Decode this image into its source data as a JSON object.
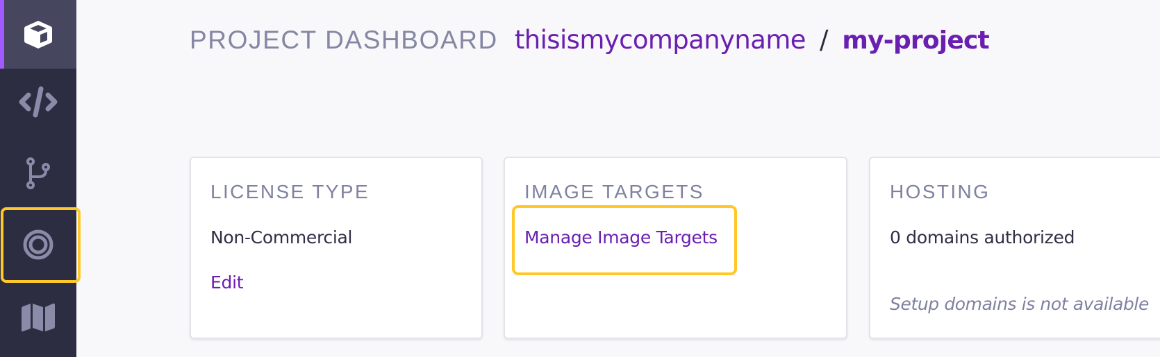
{
  "colors": {
    "sidebar_bg": "#2d2d42",
    "sidebar_active_bg": "#46465f",
    "accent_purple": "#a259ff",
    "link_purple": "#6b1fb1",
    "highlight_yellow": "#ffc828",
    "label_gray": "#7f81a0",
    "page_bg": "#f8f8fa"
  },
  "sidebar": {
    "items": [
      {
        "id": "project",
        "icon": "cube-icon",
        "active": true
      },
      {
        "id": "code",
        "icon": "code-icon",
        "active": false
      },
      {
        "id": "branches",
        "icon": "git-branch-icon",
        "active": false
      },
      {
        "id": "image-targets",
        "icon": "target-icon",
        "active": false,
        "highlighted": true
      },
      {
        "id": "map",
        "icon": "map-icon",
        "active": false
      }
    ]
  },
  "header": {
    "title": "PROJECT DASHBOARD",
    "company": "thisismycompanyname",
    "separator": "/",
    "project": "my-project"
  },
  "cards": {
    "license": {
      "label": "LICENSE TYPE",
      "value": "Non-Commercial",
      "action": "Edit"
    },
    "image_targets": {
      "label": "IMAGE TARGETS",
      "action": "Manage Image Targets",
      "highlighted": true
    },
    "hosting": {
      "label": "HOSTING",
      "value": "0 domains authorized",
      "note": "Setup domains is not available"
    }
  }
}
